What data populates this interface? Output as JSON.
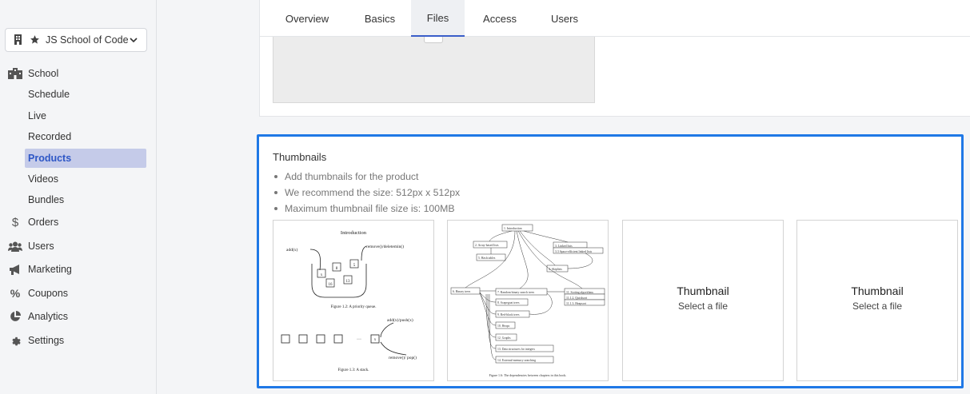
{
  "sidebar": {
    "school": {
      "name": "JS School of Code"
    },
    "nav": [
      {
        "label": "School",
        "icon": "school-icon"
      },
      {
        "label": "Orders",
        "icon": "dollar-icon"
      },
      {
        "label": "Users",
        "icon": "users-icon"
      },
      {
        "label": "Marketing",
        "icon": "megaphone-icon"
      },
      {
        "label": "Coupons",
        "icon": "percent-icon"
      },
      {
        "label": "Analytics",
        "icon": "pie-chart-icon"
      },
      {
        "label": "Settings",
        "icon": "gear-icon"
      }
    ],
    "school_sub": [
      "Schedule",
      "Live",
      "Recorded",
      "Products",
      "Videos",
      "Bundles"
    ],
    "active_sub": "Products"
  },
  "tabs": [
    "Overview",
    "Basics",
    "Files",
    "Access",
    "Users"
  ],
  "active_tab": "Files",
  "thumbnails": {
    "title": "Thumbnails",
    "hints": [
      "Add thumbnails for the product",
      "We recommend the size: 512px x 512px",
      "Maximum thumbnail file size is: 100MB"
    ],
    "slots": [
      {
        "kind": "image",
        "fig1_title": "Introduction",
        "fig1_add": "add(x)",
        "fig1_remove": "remove()/deletemin()",
        "fig1_nums": [
          "8",
          "5",
          "x",
          "16",
          "13"
        ],
        "fig1_caption": "Figure 1.2: A priority queue.",
        "fig2_push": "add(x)/push(x)",
        "fig2_pop": "remove()/ pop()",
        "fig2_dots": "···",
        "fig2_x": "x",
        "fig2_caption": "Figure 1.3: A stack."
      },
      {
        "kind": "image",
        "caption": "Figure 1.6: The dependencies between chapters in this book.",
        "nodes": [
          "1. Introduction",
          "2. Array-based lists",
          "3. Linked lists",
          "3.3 Space-efficient linked lists",
          "4. Skiplists",
          "5. Hash tables",
          "6. Binary trees",
          "7. Random binary search trees",
          "8. Scapegoat trees",
          "9. Red-black trees",
          "10. Heaps",
          "11. Sorting algorithms",
          "11.1.2. Quicksort",
          "11.1.3. Heapsort",
          "12. Graphs",
          "13. Data structures for integers",
          "14. External-memory searching"
        ]
      },
      {
        "kind": "placeholder",
        "title": "Thumbnail",
        "sub": "Select a file"
      },
      {
        "kind": "placeholder",
        "title": "Thumbnail",
        "sub": "Select a file"
      }
    ]
  },
  "colors": {
    "accent": "#1f78e6",
    "active_nav_bg": "#c5cbe9",
    "active_nav_text": "#2e57c6"
  }
}
